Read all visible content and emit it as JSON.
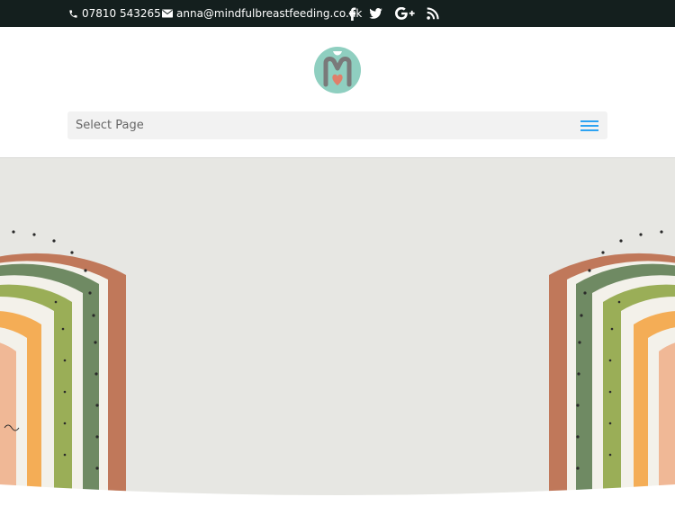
{
  "topbar": {
    "phone": "07810 543265",
    "email": "anna@mindfulbreastfeeding.co.uk",
    "icons": [
      "phone-icon",
      "envelope-icon",
      "facebook-icon",
      "twitter-icon",
      "google-plus-icon",
      "rss-icon"
    ],
    "bg_color": "#141f1e"
  },
  "header": {
    "logo_icon": "m-heart-logo",
    "nav_label": "Select Page",
    "menu_icon": "hamburger-icon",
    "accent": "#2ea3f2"
  },
  "hero": {
    "bg_color": "#e7e7e3",
    "decoration": "watercolor-rainbow"
  }
}
